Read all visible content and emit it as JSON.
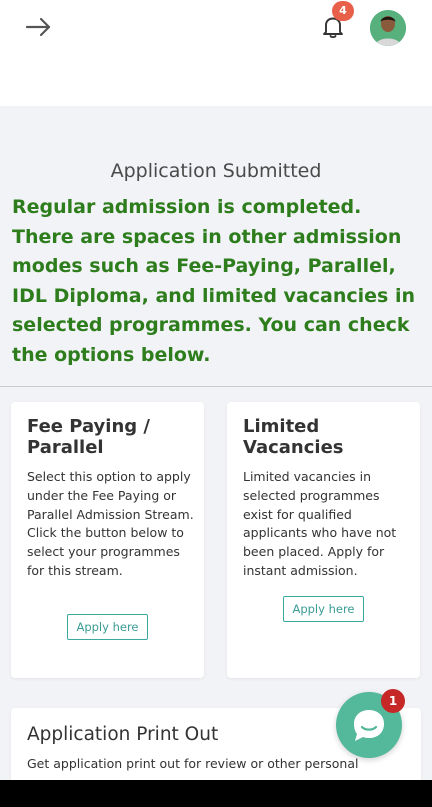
{
  "header": {
    "back_icon": "arrow-right-icon",
    "notification_icon": "bell-icon",
    "notification_count": "4",
    "avatar_icon": "user-avatar"
  },
  "status": {
    "title": "Application Submitted",
    "message": "Regular admission is completed. There are spaces in other admission modes such as Fee-Paying, Parallel, IDL Diploma, and limited vacancies in selected programmes. You can check the options below.",
    "message_color": "#2e7d1d"
  },
  "cards": {
    "fee_paying": {
      "title": "Fee Paying / Parallel",
      "description": "Select this option to apply under the Fee Paying or Parallel Admission Stream. Click the button below to select your programmes for this stream.",
      "button": "Apply here"
    },
    "limited": {
      "title": "Limited Vacancies",
      "description": "Limited vacancies in selected programmes exist for qualified applicants who have not been placed. Apply for instant admission.",
      "button": "Apply here"
    },
    "print": {
      "title": "Application Print Out",
      "description": "Get application print out for review or other personal"
    }
  },
  "chat": {
    "icon": "chat-bubble-icon",
    "unread_count": "1",
    "color": "#54b89a"
  },
  "colors": {
    "accent": "#3aa9a0",
    "badge": "#e8604a"
  }
}
